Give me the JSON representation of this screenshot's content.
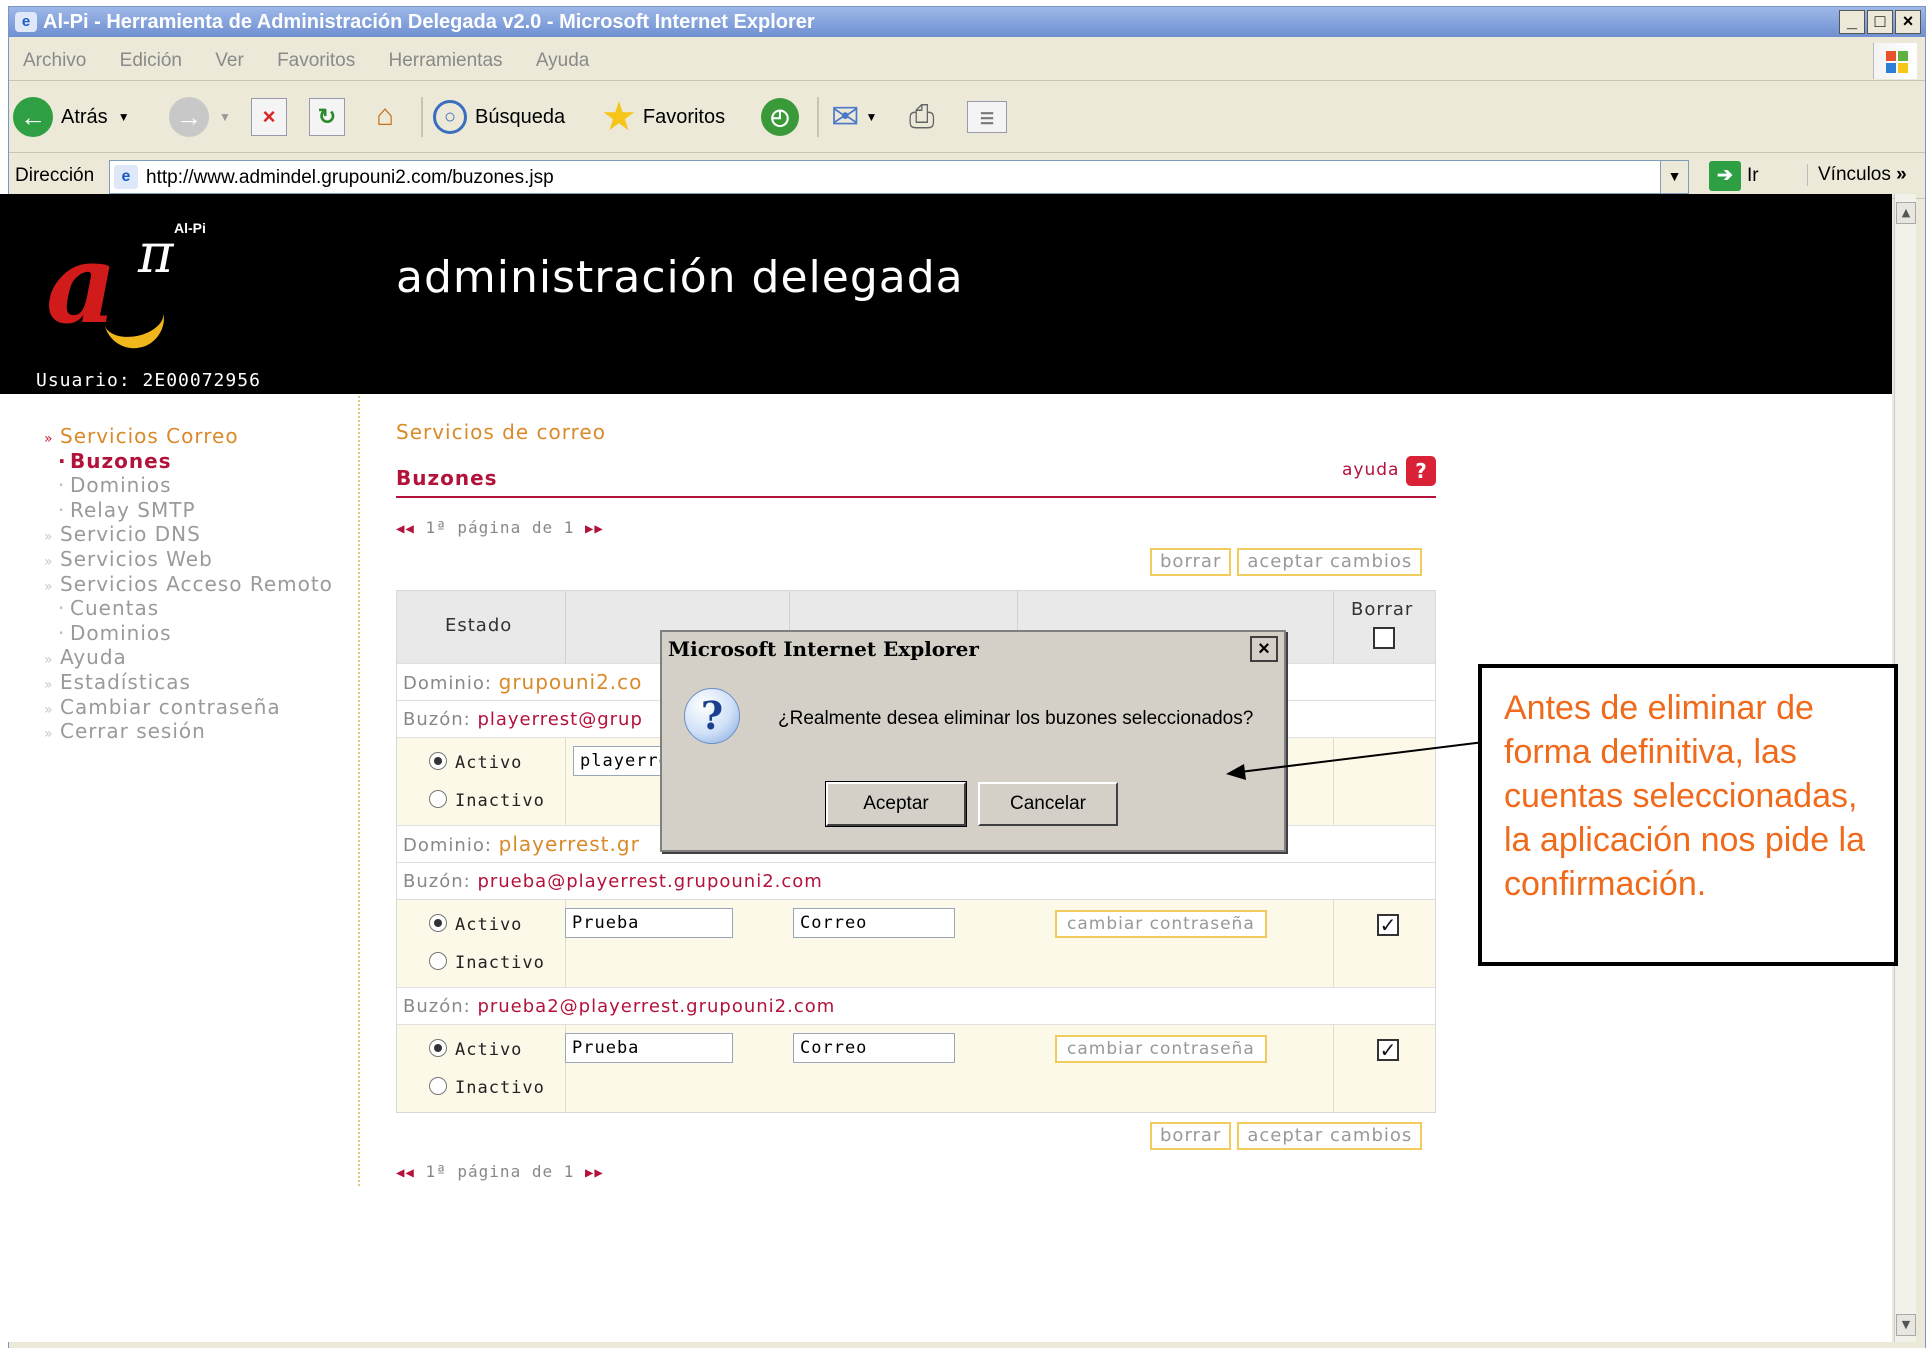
{
  "window": {
    "title": "Al-Pi - Herramienta de Administración Delegada v2.0 - Microsoft Internet Explorer",
    "buttons": {
      "minimize": "_",
      "maximize": "□",
      "close": "×"
    }
  },
  "menu": [
    "Archivo",
    "Edición",
    "Ver",
    "Favoritos",
    "Herramientas",
    "Ayuda"
  ],
  "toolbar": {
    "back_label": "Atrás",
    "search_label": "Búsqueda",
    "favorites_label": "Favoritos"
  },
  "address": {
    "label": "Dirección",
    "url": "http://www.admindel.grupouni2.com/buzones.jsp",
    "go_label": "Ir",
    "links_label": "Vínculos"
  },
  "site": {
    "logo_text": "Al-Pi",
    "title": "administración delegada",
    "user_label": "Usuario: 2E00072956"
  },
  "sidebar": {
    "items": [
      {
        "label": "Servicios Correo",
        "kind": "section",
        "active": true
      },
      {
        "label": "Buzones",
        "kind": "sub",
        "current": true
      },
      {
        "label": "Dominios",
        "kind": "sub"
      },
      {
        "label": "Relay SMTP",
        "kind": "sub"
      },
      {
        "label": "Servicio DNS",
        "kind": "section"
      },
      {
        "label": "Servicios Web",
        "kind": "section"
      },
      {
        "label": "Servicios Acceso Remoto",
        "kind": "section"
      },
      {
        "label": "Cuentas",
        "kind": "sub"
      },
      {
        "label": "Dominios",
        "kind": "sub"
      },
      {
        "label": "Ayuda",
        "kind": "section"
      },
      {
        "label": "Estadísticas",
        "kind": "section"
      },
      {
        "label": "Cambiar contraseña",
        "kind": "section"
      },
      {
        "label": "Cerrar sesión",
        "kind": "section"
      }
    ]
  },
  "main": {
    "breadcrumb": "Servicios de correo",
    "section_title": "Buzones",
    "help_label": "ayuda",
    "pager": "1ª página de 1",
    "delete_label": "borrar",
    "accept_label": "aceptar cambios",
    "change_password_label": "cambiar contraseña",
    "table": {
      "headers": {
        "estado": "Estado",
        "borrar": "Borrar"
      },
      "domain_label": "Dominio:",
      "mailbox_label": "Buzón:",
      "active_label": "Activo",
      "inactive_label": "Inactivo",
      "domain1": "grupouni2.co",
      "mailbox1": {
        "address": "playerrest@grup",
        "name": "playerre"
      },
      "domain2": "playerrest.gr",
      "mailbox2": {
        "address": "prueba@playerrest.grupouni2.com",
        "name": "Prueba",
        "surname": "Correo",
        "checked": "✓"
      },
      "mailbox3": {
        "address": "prueba2@playerrest.grupouni2.com",
        "name": "Prueba",
        "surname": "Correo",
        "checked": "✓"
      }
    }
  },
  "dialog": {
    "title": "Microsoft Internet Explorer",
    "icon": "?",
    "message": "¿Realmente desea eliminar los buzones seleccionados?",
    "ok_label": "Aceptar",
    "cancel_label": "Cancelar",
    "close": "×"
  },
  "callout": {
    "text": "Antes de eliminar de forma definitiva, las cuentas seleccionadas, la aplicación nos pide la confirmación."
  },
  "colors": {
    "brand_red": "#b3123a",
    "accent_orange": "#d98a2a",
    "callout_orange": "#f06a1c",
    "button_border": "#f1cc5c"
  }
}
